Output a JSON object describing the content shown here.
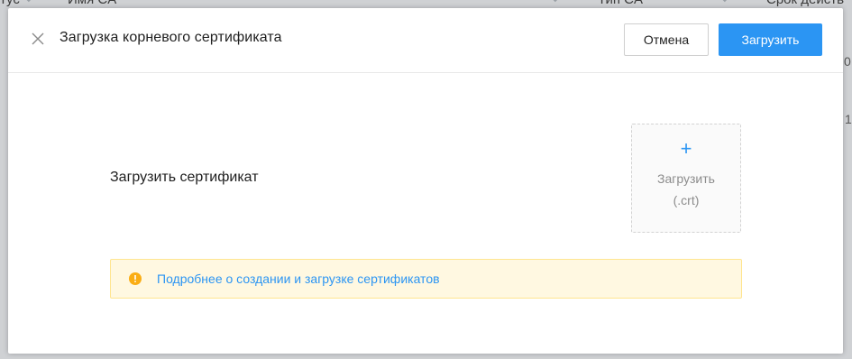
{
  "background_table": {
    "columns": [
      "тус",
      "Имя CA",
      "Тип CA",
      "Срок действ"
    ],
    "right_edge_chars": [
      "0",
      "1"
    ]
  },
  "modal": {
    "title": "Загрузка корневого сертификата",
    "cancel_label": "Отмена",
    "upload_label": "Загрузить",
    "close_icon": "close-icon",
    "field_label": "Загрузить сертификат",
    "dropzone": {
      "plus": "+",
      "line1": "Загрузить",
      "line2": "(.crt)"
    },
    "alert": {
      "icon": "warning-icon",
      "link_text": "Подробнее о создании и загрузке сертификатов"
    }
  },
  "colors": {
    "accent": "#2b95f3",
    "alert_bg": "#fff8e1",
    "alert_border": "#ffe58f",
    "alert_icon": "#faad14"
  }
}
